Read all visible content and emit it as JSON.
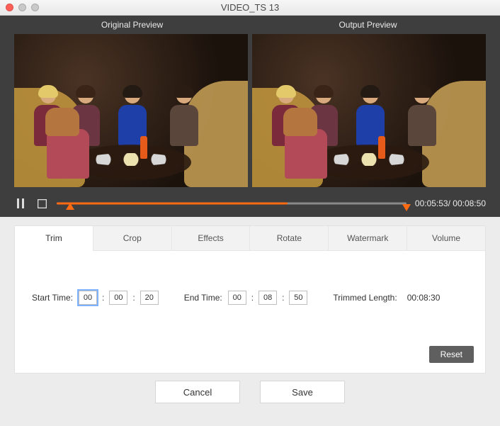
{
  "window": {
    "title": "VIDEO_TS 13"
  },
  "preview": {
    "original_label": "Original Preview",
    "output_label": "Output  Preview"
  },
  "playback": {
    "current_time": "00:05:53",
    "total_time": "00:08:50",
    "separator": "/ ",
    "progress_percent": 66
  },
  "tabs": {
    "items": [
      "Trim",
      "Crop",
      "Effects",
      "Rotate",
      "Watermark",
      "Volume"
    ],
    "active_index": 0
  },
  "trim": {
    "start_label": "Start Time:",
    "end_label": "End Time:",
    "length_label": "Trimmed Length:",
    "start": {
      "h": "00",
      "m": "00",
      "s": "20"
    },
    "end": {
      "h": "00",
      "m": "08",
      "s": "50"
    },
    "trimmed_length": "00:08:30",
    "reset_label": "Reset"
  },
  "buttons": {
    "cancel": "Cancel",
    "save": "Save"
  },
  "colors": {
    "accent": "#ff6a13"
  }
}
